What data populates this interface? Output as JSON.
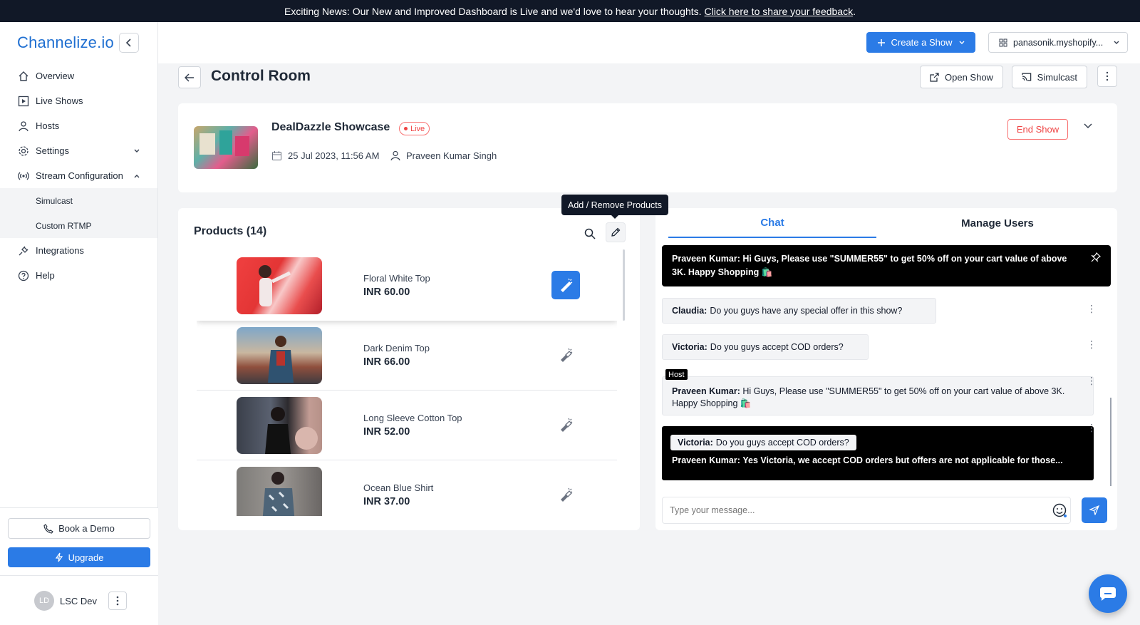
{
  "banner": {
    "text": "Exciting News: Our New and Improved Dashboard is Live and we'd love to hear your thoughts.",
    "link": "Click here to share your feedback",
    "end": "."
  },
  "sidebar": {
    "logo": "Channelize.io",
    "items": [
      {
        "label": "Overview",
        "icon": "home-icon"
      },
      {
        "label": "Live Shows",
        "icon": "play-icon"
      },
      {
        "label": "Hosts",
        "icon": "user-icon"
      },
      {
        "label": "Settings",
        "icon": "gear-icon"
      },
      {
        "label": "Stream Configuration",
        "icon": "broadcast-icon"
      },
      {
        "label": "Integrations",
        "icon": "plug-icon"
      },
      {
        "label": "Help",
        "icon": "question-icon"
      }
    ],
    "subitems": [
      {
        "label": "Simulcast"
      },
      {
        "label": "Custom RTMP"
      }
    ],
    "book_demo": "Book a Demo",
    "upgrade": "Upgrade",
    "user": {
      "initials": "LD",
      "name": "LSC Dev"
    }
  },
  "topbar": {
    "create_show": "Create a Show",
    "store": "panasonik.myshopify..."
  },
  "page": {
    "title": "Control Room",
    "open_show": "Open Show",
    "simulcast": "Simulcast"
  },
  "show": {
    "title": "DealDazzle Showcase",
    "status": "Live",
    "date": "25 Jul 2023, 11:56 AM",
    "host": "Praveen Kumar Singh",
    "end_show": "End Show"
  },
  "products": {
    "title": "Products (14)",
    "tooltip": "Add / Remove Products",
    "items": [
      {
        "name": "Floral White Top",
        "price": "INR 60.00",
        "spotlight": true
      },
      {
        "name": "Dark Denim Top",
        "price": "INR 66.00",
        "spotlight": false
      },
      {
        "name": "Long Sleeve Cotton Top",
        "price": "INR 52.00",
        "spotlight": false
      },
      {
        "name": "Ocean Blue Shirt",
        "price": "INR 37.00",
        "spotlight": false
      }
    ]
  },
  "chat": {
    "tabs": [
      "Chat",
      "Manage Users"
    ],
    "pinned": {
      "author": "Praveen Kumar:",
      "text": "Hi Guys, Please use \"SUMMER55\" to get 50% off on your cart value of above 3K. Happy Shopping 🛍️"
    },
    "messages": [
      {
        "author": "Claudia:",
        "text": "Do you guys have any special offer in this show?"
      },
      {
        "author": "Victoria:",
        "text": "Do you guys accept COD orders?"
      }
    ],
    "host_tag": "Host",
    "host_message": {
      "author": "Praveen Kumar:",
      "text": "Hi Guys, Please use \"SUMMER55\" to get 50% off on your cart value of above 3K. Happy Shopping 🛍️"
    },
    "reply": {
      "quote_author": "Victoria:",
      "quote_text": "Do you guys accept COD orders?",
      "author": "Praveen Kumar:",
      "text": "Yes Victoria, we accept COD orders but offers are not applicable for those..."
    },
    "input_placeholder": "Type your message..."
  },
  "colors": {
    "accent": "#2b7be6",
    "danger": "#ef4444",
    "banner": "#111827"
  }
}
